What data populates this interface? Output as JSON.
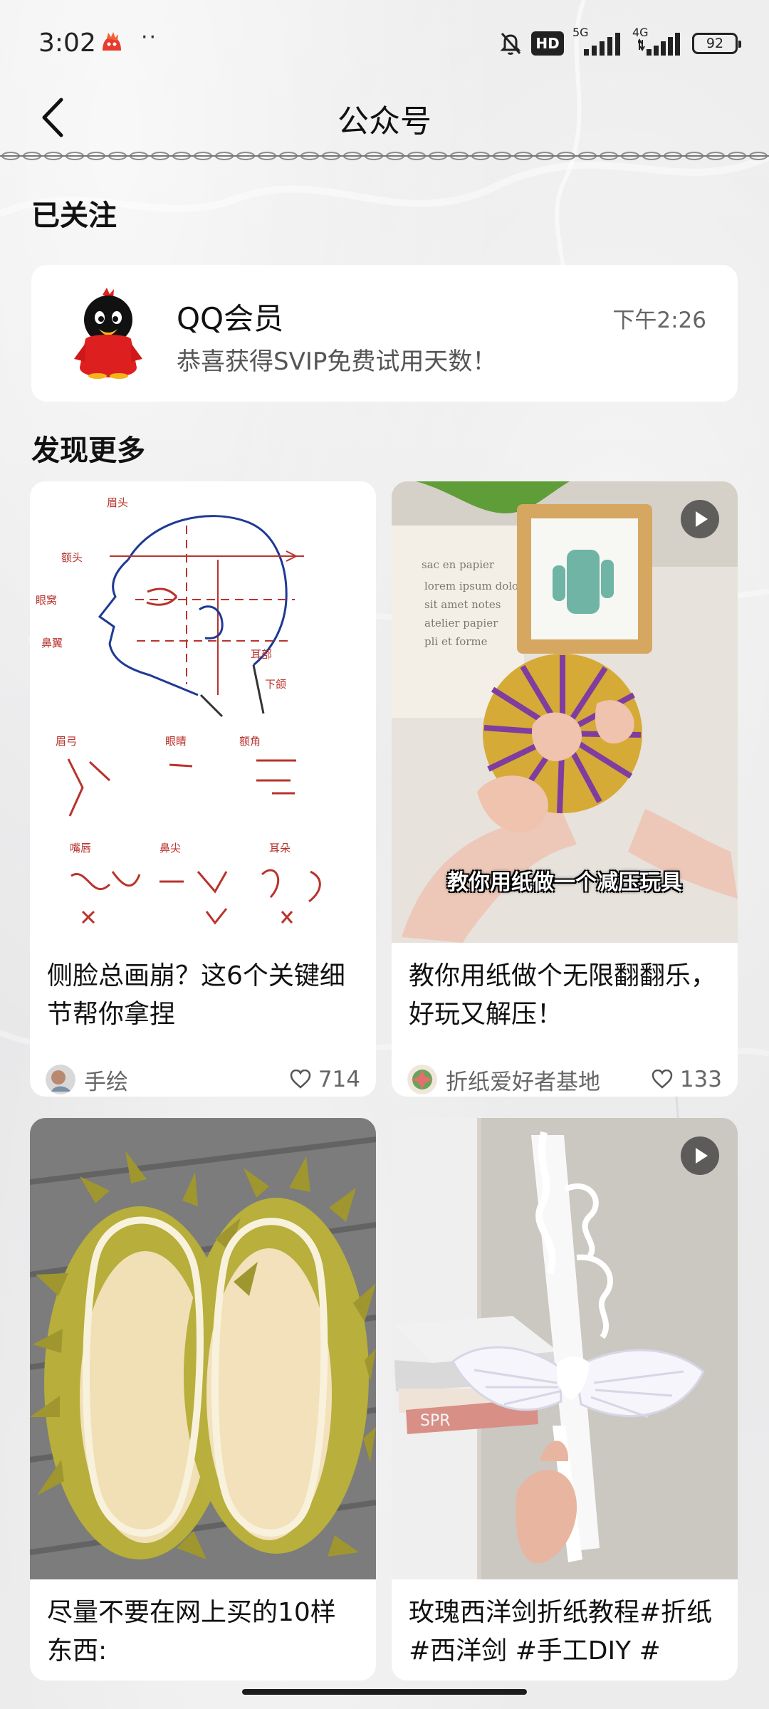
{
  "status_bar": {
    "time": "3:02",
    "app_icon": "red-app-icon",
    "more_indicator": "··",
    "hd_label": "HD",
    "network_1": "5G",
    "network_2": "4G",
    "battery": "92"
  },
  "nav": {
    "title": "公众号",
    "back_icon": "chevron-left-icon"
  },
  "followed": {
    "section_title": "已关注",
    "account": {
      "name": "QQ会员",
      "message": "恭喜获得SVIP免费试用天数！",
      "time": "下午2:26",
      "avatar_icon": "penguin-avatar-icon"
    }
  },
  "discover": {
    "section_title": "发现更多",
    "items": [
      {
        "title": "侧脸总画崩？这6个关键细节帮你拿捏",
        "author": "手绘",
        "likes": "714",
        "thumbnail": "side-face-sketch-image"
      },
      {
        "title": "教你用纸做个无限翻翻乐，好玩又解压！",
        "author": "折纸爱好者基地",
        "likes": "133",
        "thumbnail": "paper-toy-video-image",
        "video_caption": "教你用纸做一个减压玩具",
        "has_video": true
      },
      {
        "title": "尽量不要在网上买的10样东西:",
        "thumbnail": "durian-slippers-image"
      },
      {
        "title": "玫瑰西洋剑折纸教程#折纸 #西洋剑 #手工DIY #",
        "thumbnail": "paper-sword-video-image",
        "has_video": true
      }
    ]
  }
}
